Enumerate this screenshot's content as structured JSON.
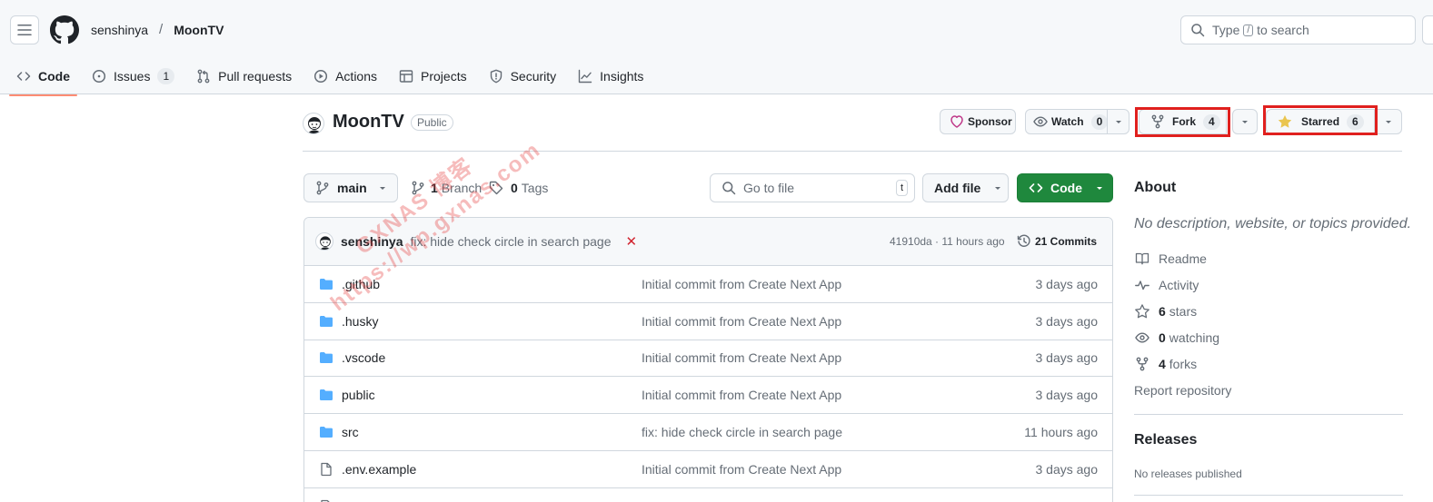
{
  "header": {
    "owner": "senshinya",
    "separator": "/",
    "repo": "MoonTV",
    "search": {
      "prefix": "Type",
      "key": "/",
      "suffix": "to search"
    }
  },
  "nav": {
    "tabs": [
      {
        "label": "Code",
        "icon": "code-icon",
        "selected": true
      },
      {
        "label": "Issues",
        "icon": "issue-icon",
        "count": "1"
      },
      {
        "label": "Pull requests",
        "icon": "pull-request-icon"
      },
      {
        "label": "Actions",
        "icon": "play-icon"
      },
      {
        "label": "Projects",
        "icon": "table-icon"
      },
      {
        "label": "Security",
        "icon": "shield-icon"
      },
      {
        "label": "Insights",
        "icon": "graph-icon"
      }
    ]
  },
  "repo": {
    "name": "MoonTV",
    "visibility": "Public",
    "sponsor_label": "Sponsor",
    "watch_label": "Watch",
    "watch_count": "0",
    "fork_label": "Fork",
    "fork_count": "4",
    "star_label": "Starred",
    "star_count": "6"
  },
  "toolbar": {
    "branch": "main",
    "branches_count": "1",
    "branches_label": "Branch",
    "tags_count": "0",
    "tags_label": "Tags",
    "goto_placeholder": "Go to file",
    "goto_key": "t",
    "add_file_label": "Add file",
    "code_label": "Code"
  },
  "latest_commit": {
    "author": "senshinya",
    "message": "fix: hide check circle in search page",
    "status": "✕",
    "hash": "41910da",
    "time": "11 hours ago",
    "hash_time": "41910da · 11 hours ago",
    "commits_count": "21",
    "commits_label": "21 Commits"
  },
  "files": [
    {
      "name": ".github",
      "type": "dir",
      "message": "Initial commit from Create Next App",
      "time": "3 days ago"
    },
    {
      "name": ".husky",
      "type": "dir",
      "message": "Initial commit from Create Next App",
      "time": "3 days ago"
    },
    {
      "name": ".vscode",
      "type": "dir",
      "message": "Initial commit from Create Next App",
      "time": "3 days ago"
    },
    {
      "name": "public",
      "type": "dir",
      "message": "Initial commit from Create Next App",
      "time": "3 days ago"
    },
    {
      "name": "src",
      "type": "dir",
      "message": "fix: hide check circle in search page",
      "time": "11 hours ago"
    },
    {
      "name": ".env.example",
      "type": "file",
      "message": "Initial commit from Create Next App",
      "time": "3 days ago"
    }
  ],
  "about": {
    "title": "About",
    "description": "No description, website, or topics provided.",
    "readme": "Readme",
    "activity": "Activity",
    "stars_count": "6",
    "stars_label": "stars",
    "watching_count": "0",
    "watching_label": "watching",
    "forks_count": "4",
    "forks_label": "forks",
    "report": "Report repository"
  },
  "releases": {
    "title": "Releases",
    "empty": "No releases published"
  },
  "watermark": {
    "line1": "GXNAS 博客",
    "line2": "https://wp.gxnas.com"
  },
  "colors": {
    "accent_green": "#1f883d",
    "nav_underline": "#fd8c73",
    "highlight_red": "#e0201e",
    "folder_blue": "#54aeff",
    "star_yellow": "#eac54f",
    "sponsor_pink": "#bf3989"
  }
}
